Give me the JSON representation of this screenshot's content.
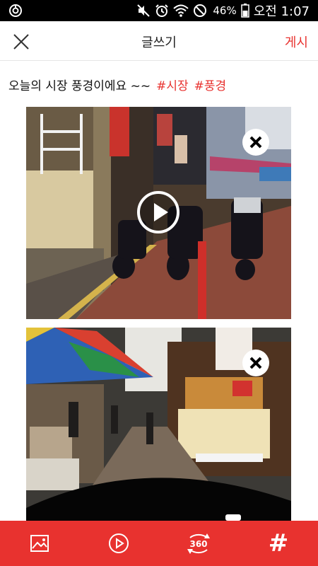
{
  "status_bar": {
    "battery_percent": "46%",
    "time": "오전 1:07",
    "icons": [
      "app-notification-icon",
      "mute-icon",
      "alarm-icon",
      "wifi-icon",
      "do-not-disturb-icon",
      "battery-icon"
    ]
  },
  "header": {
    "title": "글쓰기",
    "post_label": "게시",
    "close_icon": "close-icon"
  },
  "post": {
    "text": "오늘의 시장 풍경이에요 ~~",
    "hashtags": [
      "#시장",
      "#풍경"
    ]
  },
  "media": [
    {
      "kind": "video",
      "description_icon": "play-icon"
    },
    {
      "kind": "photo",
      "description_icon": "none"
    }
  ],
  "toolbar": {
    "items": [
      "image-icon",
      "video-icon",
      "360-icon",
      "hashtag-icon"
    ],
    "hashtag_symbol": "#",
    "icon_360_label": "360"
  },
  "colors": {
    "accent": "#e8322f",
    "status_bar": "#000000",
    "background": "#ffffff"
  }
}
